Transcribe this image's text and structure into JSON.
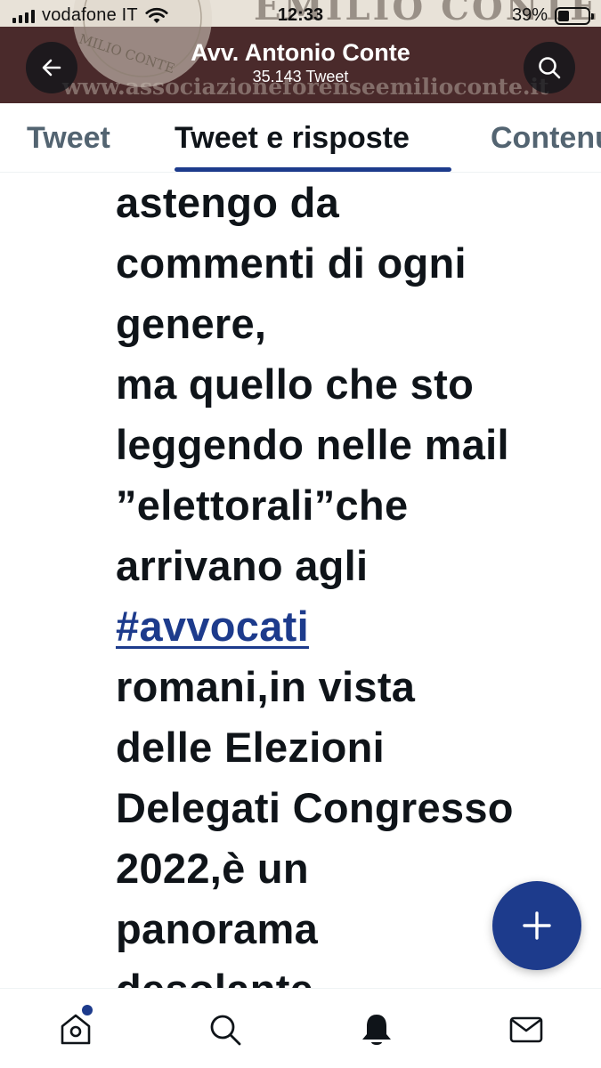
{
  "status_bar": {
    "carrier": "vodafone IT",
    "time": "12:33",
    "battery": "39%",
    "battery_level": 0.39
  },
  "header": {
    "title": "Avv. Antonio Conte",
    "subtitle": "35.143 Tweet",
    "banner_text": "www.associazioneforenseemilioconte.it",
    "banner_top_text": "EMILIO CONTE",
    "banner_seal_text": "MILIO CONTE"
  },
  "tabs": [
    {
      "label": "Tweet",
      "selected": false
    },
    {
      "label": "Tweet e risposte",
      "selected": true
    },
    {
      "label": "Contenuti multimediali",
      "selected": false
    }
  ],
  "tweet": {
    "lines": [
      "astengo da",
      "commenti di ogni",
      "genere,",
      "ma quello che sto",
      "leggendo nelle mail",
      "”elettorali”che",
      "arrivano agli",
      "#avvocati",
      "romani,in vista",
      "delle Elezioni",
      "Delegati Congresso",
      "2022,è un",
      "panorama",
      "desolante."
    ],
    "hashtag_line_index": 7
  },
  "fab": {
    "icon": "plus-icon"
  },
  "bottom_nav": [
    {
      "icon": "home-icon",
      "has_dot": true
    },
    {
      "icon": "search-icon"
    },
    {
      "icon": "bell-icon"
    },
    {
      "icon": "mail-icon"
    }
  ],
  "colors": {
    "accent": "#1d3b8c",
    "banner": "#4a2a2b",
    "text": "#0f1419",
    "muted": "#536471"
  }
}
